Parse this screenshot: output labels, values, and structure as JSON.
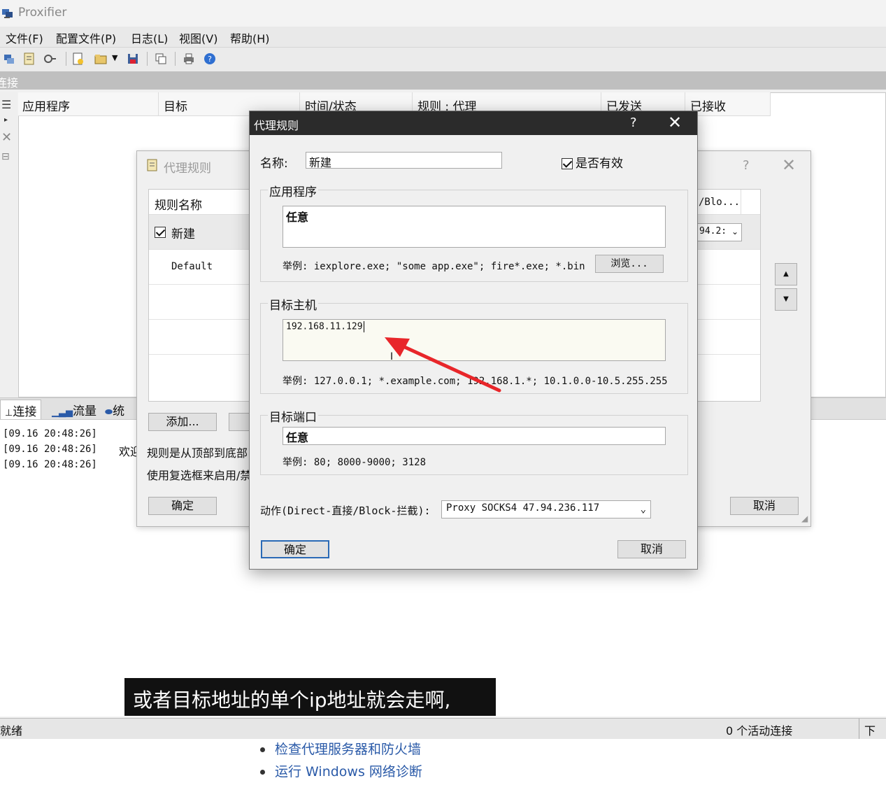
{
  "window": {
    "title": "Proxifier",
    "menu": [
      "文件(F)",
      "配置文件(P)",
      "日志(L)",
      "视图(V)",
      "帮助(H)"
    ],
    "connections_strip": "连接"
  },
  "connections": {
    "columns": [
      "应用程序",
      "目标",
      "时间/状态",
      "规则 : 代理",
      "已发送",
      "已接收"
    ]
  },
  "bottom_tabs": [
    "连接",
    "流量",
    "统"
  ],
  "log": {
    "lines": [
      "[09.16 20:48:26]",
      "[09.16 20:48:26]",
      "[09.16 20:48:26]"
    ],
    "partial_text": "欢迎"
  },
  "statusbar": {
    "left": "就绪",
    "active": "0 个活动连接",
    "right": "下载"
  },
  "below_window": {
    "links": [
      "检查代理服务器和防火墙",
      "运行 Windows 网络诊断"
    ]
  },
  "rules_dialog": {
    "title": "代理规则",
    "help": "?",
    "close": "✕",
    "column_name": "规则名称",
    "column_partial_right": "/Blo...",
    "rows": [
      {
        "name": "新建",
        "checked": true
      },
      {
        "name": "Default",
        "checked": false
      }
    ],
    "proxy_partial": "94.2:",
    "add_button": "添加...",
    "info1": "规则是从顶部到底部",
    "info2": "使用复选框来启用/禁",
    "ok_button": "确定",
    "cancel_button": "取消"
  },
  "edit_dialog": {
    "title": "代理规则",
    "help": "?",
    "close": "✕",
    "name_label": "名称:",
    "name_value": "新建",
    "enabled_label": "是否有效",
    "enabled": true,
    "apps_group": "应用程序",
    "apps_value": "任意",
    "apps_example": "举例: iexplore.exe; \"some app.exe\"; fire*.exe; *.bin",
    "browse_button": "浏览...",
    "hosts_group": "目标主机",
    "hosts_value": "192.168.11.129",
    "hosts_example": "举例: 127.0.0.1; *.example.com; 192.168.1.*; 10.1.0.0-10.5.255.255",
    "ports_group": "目标端口",
    "ports_value": "任意",
    "ports_example": "举例: 80; 8000-9000; 3128",
    "action_label": "动作(Direct-直接/Block-拦截):",
    "action_value": "Proxy SOCKS4 47.94.236.117",
    "ok_button": "确定",
    "cancel_button": "取消"
  },
  "caption": {
    "text": "或者目标地址的单个ip地址就会走啊,"
  },
  "colors": {
    "arrow": "#e8262a",
    "dialog_titlebar": "#2b2b2b",
    "link": "#2a5aa8"
  }
}
